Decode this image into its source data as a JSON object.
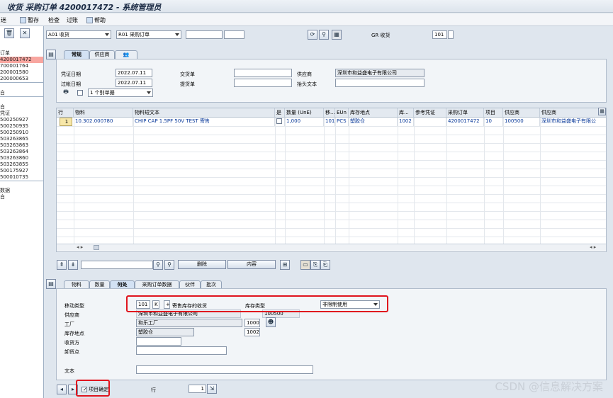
{
  "title": "收货 采购订单 4200017472 - 系统管理员",
  "menu": {
    "item0": "迷",
    "item1": "暂存",
    "item2": "检查",
    "item3": "过账",
    "item4": "帮助"
  },
  "header": {
    "action_dd": "A01 收货",
    "ref_dd": "R01 采购订单",
    "gr_label": "GR 收货",
    "gr_code": "101"
  },
  "left": {
    "items": [
      "订单",
      "4200017472",
      "700001764",
      "200001580",
      "200000653",
      "",
      "白",
      "",
      "白",
      "凭证",
      "500250927",
      "500250935",
      "500250910",
      "503263865",
      "503263863",
      "503263864",
      "503263860",
      "503263855",
      "500175927",
      "500010735",
      "",
      "数据",
      "白"
    ],
    "selected_index": 1
  },
  "tabs_top": [
    "常规",
    "供应商",
    ""
  ],
  "general": {
    "doc_date_label": "凭证日期",
    "doc_date": "2022.07.11",
    "post_date_label": "过帐日期",
    "post_date": "2022.07.11",
    "delivery_note_label": "交货单",
    "bill_label": "提货单",
    "vendor_label": "供应商",
    "vendor_value": "深圳市和益盛电子有限公司",
    "header_text_label": "抬头文本",
    "slip_dd": "1 个别单据"
  },
  "grid": {
    "headers": [
      "行",
      "物料",
      "物料短文本",
      "是",
      "数量 (UnE)",
      "移...",
      "EUn",
      "库存地点",
      "库...",
      "参考凭证",
      "采购订单",
      "项目",
      "供应商",
      "供应商"
    ],
    "row": [
      "1",
      "10.302.000780",
      "CHIP CAP 1.5PF 50V TEST 寄售",
      "",
      "1,000",
      "101",
      "PCS",
      "塑胶仓",
      "1002",
      "",
      "4200017472",
      "10",
      "100500",
      "深圳市和益盛电子有限公"
    ]
  },
  "toolbar2": {
    "delete": "删除",
    "content": "内容"
  },
  "tabs_bottom": [
    "物料",
    "数量",
    "何处",
    "采购订单数据",
    "伙伴",
    "批次"
  ],
  "detail": {
    "mvt_label": "移动类型",
    "mvt_code": "101",
    "mvt_k": "K",
    "mvt_plus": "+",
    "mvt_text": "寄售库存的收货",
    "stock_type_label": "库存类型",
    "stock_type": "非限制使用",
    "vendor_label": "供应商",
    "vendor_name": "深圳市和益盛电子有限公司",
    "vendor_code": "100500",
    "plant_label": "工厂",
    "plant_name": "和乐工厂",
    "plant_code": "1000",
    "sloc_label": "库存地点",
    "sloc_name": "塑胶仓",
    "sloc_code": "1002",
    "goods_recipient_label": "收货方",
    "unloading_label": "卸货点",
    "text_label": "文本"
  },
  "footer": {
    "item_ok_label": "项目确定",
    "line_label": "行",
    "line_value": "1"
  },
  "watermark": "CSDN @信息解决方案"
}
